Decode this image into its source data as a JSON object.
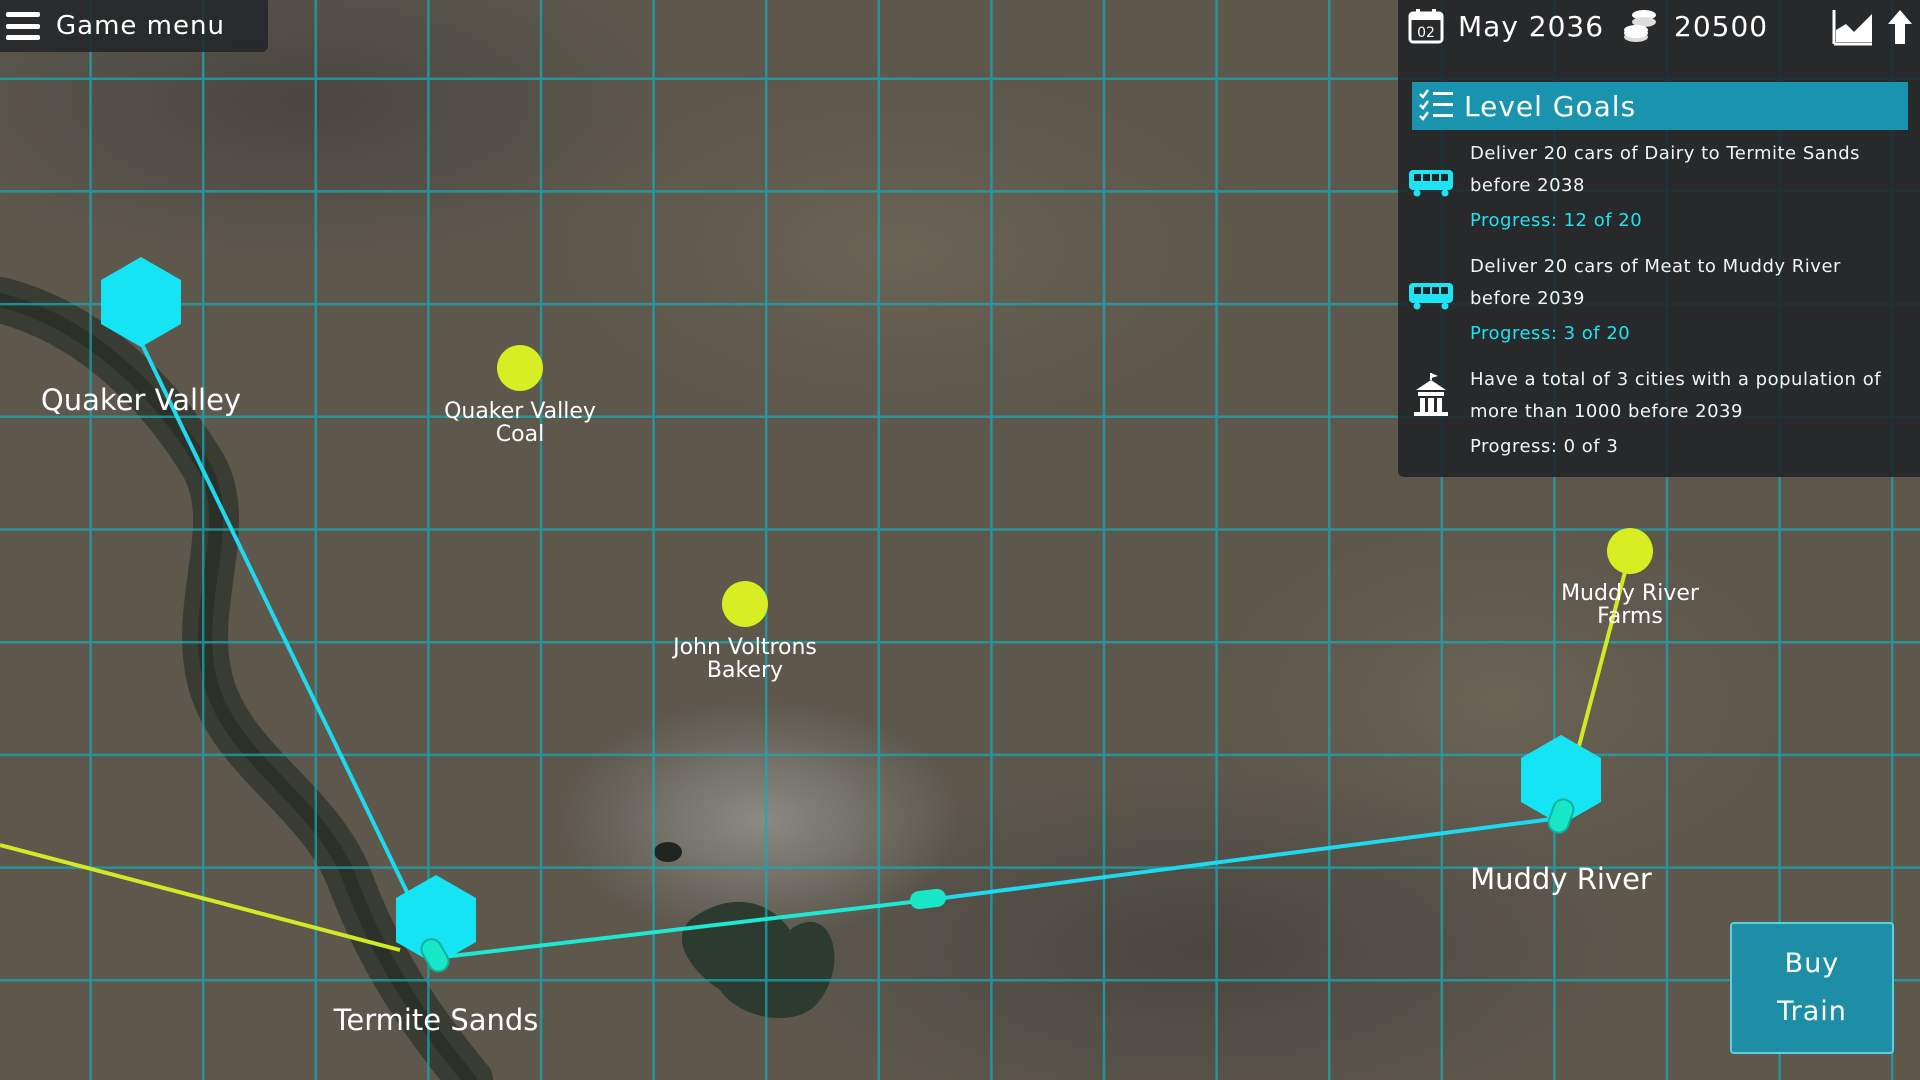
{
  "app": {
    "title": "Game menu"
  },
  "status": {
    "calendar_day": "02",
    "date": "May 2036",
    "money": "20500",
    "icons": {
      "calendar": "calendar-icon",
      "coins": "coins-icon",
      "stats": "stats-chart-icon",
      "upgrade": "upgrade-arrow-icon"
    }
  },
  "goals": {
    "title": "Level Goals",
    "items": [
      {
        "text": "Deliver 20 cars of Dairy to Termite Sands before 2038",
        "progress": "Progress: 12 of 20",
        "current": 12,
        "target": 20,
        "icon": "train-icon"
      },
      {
        "text": "Deliver 20 cars of Meat to Muddy River before 2039",
        "progress": "Progress: 3 of 20",
        "current": 3,
        "target": 20,
        "icon": "train-icon"
      },
      {
        "text": "Have a total of 3 cities with a population of more than 1000 before 2039",
        "progress": "Progress: 0 of 3",
        "current": 0,
        "target": 3,
        "icon": "city-hall-icon"
      }
    ]
  },
  "map": {
    "cities": [
      {
        "name": "Quaker Valley"
      },
      {
        "name": "Termite Sands"
      },
      {
        "name": "Muddy River"
      }
    ],
    "industries": [
      {
        "name_line1": "Quaker Valley",
        "name_line2": "Coal"
      },
      {
        "name_line1": "John Voltrons",
        "name_line2": "Bakery"
      },
      {
        "name_line1": "Muddy River",
        "name_line2": "Farms"
      }
    ]
  },
  "actions": {
    "buy_train": "Buy\nTrain"
  },
  "colors": {
    "accent": "#1a93ae",
    "city": "#14e4f4",
    "industry": "#d8ee22",
    "rail": "#1fd9ee",
    "grid": "#1aa8b4",
    "progress_text": "#1fe3f2"
  }
}
